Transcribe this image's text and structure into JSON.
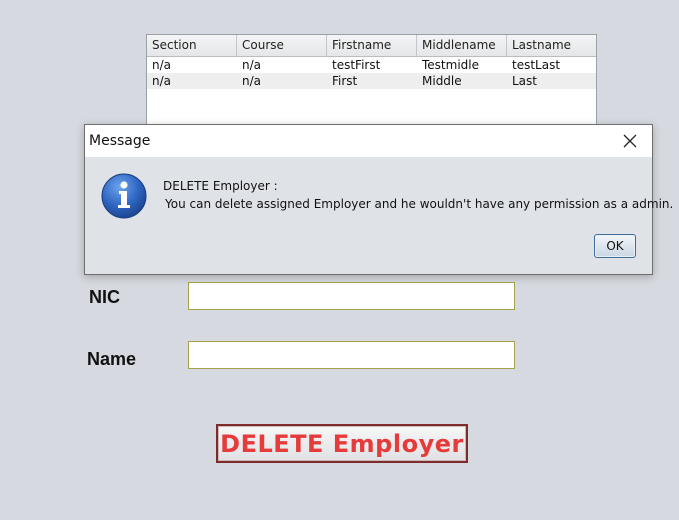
{
  "table": {
    "columns": [
      "Section",
      "Course",
      "Firstname",
      "Middlename",
      "Lastname"
    ],
    "rows": [
      [
        "n/a",
        "n/a",
        "testFirst",
        "Testmidle",
        "testLast"
      ],
      [
        "n/a",
        "n/a",
        "First",
        "Middle",
        "Last"
      ]
    ]
  },
  "form": {
    "nic_label": "NIC",
    "nic_value": "",
    "name_label": "Name",
    "name_value": "",
    "delete_label": "DELETE Employer"
  },
  "dialog": {
    "title": "Message",
    "line1": "DELETE Employer :",
    "line2": "You can delete assigned Employer and he wouldn't have  any permission as a admin.",
    "ok_label": "OK",
    "icon": "info-icon"
  },
  "colors": {
    "background": "#d6d9df",
    "delete_text": "#e53b3b",
    "info_icon": "#2a63b8"
  }
}
